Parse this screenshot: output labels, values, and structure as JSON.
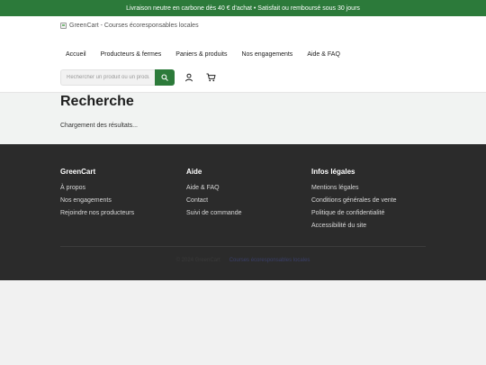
{
  "announcement": "Livraison neutre en carbone dès 40 € d'achat • Satisfait ou remboursé sous 30 jours",
  "header": {
    "logo_alt": "GreenCart - Courses écoresponsables locales",
    "nav": [
      "Accueil",
      "Producteurs & fermes",
      "Paniers & produits",
      "Nos engagements",
      "Aide & FAQ"
    ],
    "search_placeholder": "Rechercher un produit ou un producteur"
  },
  "main": {
    "title": "Recherche",
    "status": "Chargement des résultats..."
  },
  "footer": {
    "columns": [
      {
        "title": "GreenCart",
        "links": [
          "À propos",
          "Nos engagements",
          "Rejoindre nos producteurs"
        ]
      },
      {
        "title": "Aide",
        "links": [
          "Aide & FAQ",
          "Contact",
          "Suivi de commande"
        ]
      },
      {
        "title": "Infos légales",
        "links": [
          "Mentions légales",
          "Conditions générales de vente",
          "Politique de confidentialité",
          "Accessibilité du site"
        ]
      }
    ],
    "copyright": "© 2024 GreenCart",
    "bottom_link": "Courses écoresponsables locales"
  },
  "colors": {
    "brand": "#2c7a3a",
    "footer_bg": "#2b2b2b"
  }
}
